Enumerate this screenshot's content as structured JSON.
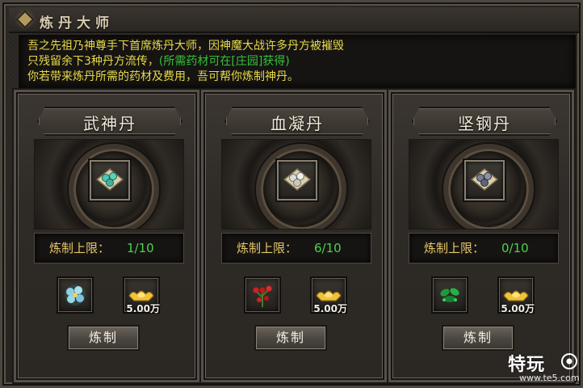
{
  "title": "炼丹大师",
  "intro": {
    "line1": "吾之先祖乃神尊手下首席炼丹大师，因神魔大战许多丹方被摧毁",
    "line2_a": "只残留余下3种丹方流传，",
    "line2_b": "(所需药材可在[庄园]获得)",
    "line3": "你若带来炼丹所需的药材及费用，吾可帮你炼制神丹。"
  },
  "limit_label": "炼制上限：",
  "craft_label": "炼制",
  "panels": [
    {
      "name": "武神丹",
      "limit": "1/10",
      "pill_icon": "teal-pill-icon",
      "material_icon": "blue-flower-herb-icon",
      "cost": "5.00万",
      "colors": {
        "pill": "#4cc7b0",
        "herb": "#8fd0e6"
      }
    },
    {
      "name": "血凝丹",
      "limit": "6/10",
      "pill_icon": "silver-pill-icon",
      "material_icon": "red-berry-herb-icon",
      "cost": "5.00万",
      "colors": {
        "pill": "#dcdcd4",
        "herb": "#d42020"
      }
    },
    {
      "name": "坚钢丹",
      "limit": "0/10",
      "pill_icon": "dark-pill-icon",
      "material_icon": "green-leaf-herb-icon",
      "cost": "5.00万",
      "colors": {
        "pill": "#7a7f93",
        "herb": "#1f9a3a"
      }
    }
  ],
  "watermark": {
    "big": "特玩",
    "small": "www.te5.com"
  }
}
